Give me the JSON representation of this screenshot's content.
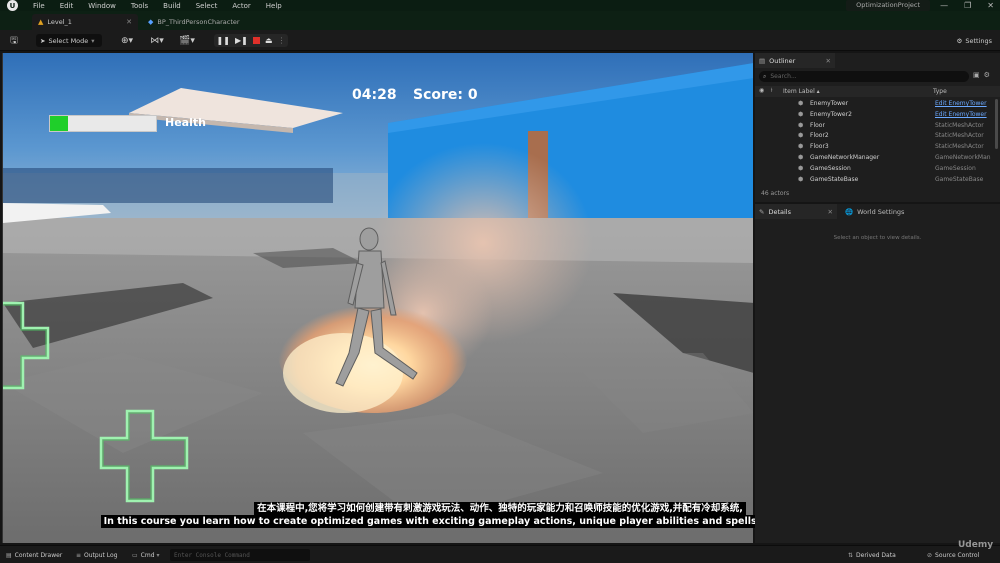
{
  "menu": [
    "File",
    "Edit",
    "Window",
    "Tools",
    "Build",
    "Select",
    "Actor",
    "Help"
  ],
  "project_name": "OptimizationProject",
  "window_controls": [
    "—",
    "❐",
    "✕"
  ],
  "tabs": [
    {
      "label": "Level_1"
    },
    {
      "label": "BP_ThirdPersonCharacter"
    }
  ],
  "toolbar": {
    "select_mode": "Select Mode",
    "settings": "Settings"
  },
  "hud": {
    "timer": "04:28",
    "score": "Score: 0",
    "health_label": "Health",
    "health_level": 0.17
  },
  "subtitles": {
    "zh": "在本课程中,您将学习如何创建带有刺激游戏玩法、动作、独特的玩家能力和召唤师技能的优化游戏,并配有冷却系统,",
    "en": "In this course you learn how to create optimized games with exciting gameplay actions, unique player abilities and spells with a cool-down system,"
  },
  "outliner": {
    "title": "Outliner",
    "search_placeholder": "Search...",
    "col_label": "Item Label ▴",
    "col_type": "Type",
    "rows": [
      {
        "name": "EnemyTower",
        "type": "Edit EnemyTower",
        "link": true
      },
      {
        "name": "EnemyTower2",
        "type": "Edit EnemyTower",
        "link": true
      },
      {
        "name": "Floor",
        "type": "StaticMeshActor",
        "link": false
      },
      {
        "name": "Floor2",
        "type": "StaticMeshActor",
        "link": false
      },
      {
        "name": "Floor3",
        "type": "StaticMeshActor",
        "link": false
      },
      {
        "name": "GameNetworkManager",
        "type": "GameNetworkMan",
        "link": false
      },
      {
        "name": "GameSession",
        "type": "GameSession",
        "link": false
      },
      {
        "name": "GameStateBase",
        "type": "GameStateBase",
        "link": false
      }
    ],
    "actor_count": "46 actors"
  },
  "details": {
    "title": "Details",
    "world_settings": "World Settings",
    "empty_message": "Select an object to view details."
  },
  "statusbar": {
    "content_drawer": "Content Drawer",
    "output_log": "Output Log",
    "cmd": "Cmd",
    "console_placeholder": "Enter Console Command",
    "derived_data": "Derived Data",
    "source_control": "Source Control"
  },
  "watermark": "Udemy"
}
